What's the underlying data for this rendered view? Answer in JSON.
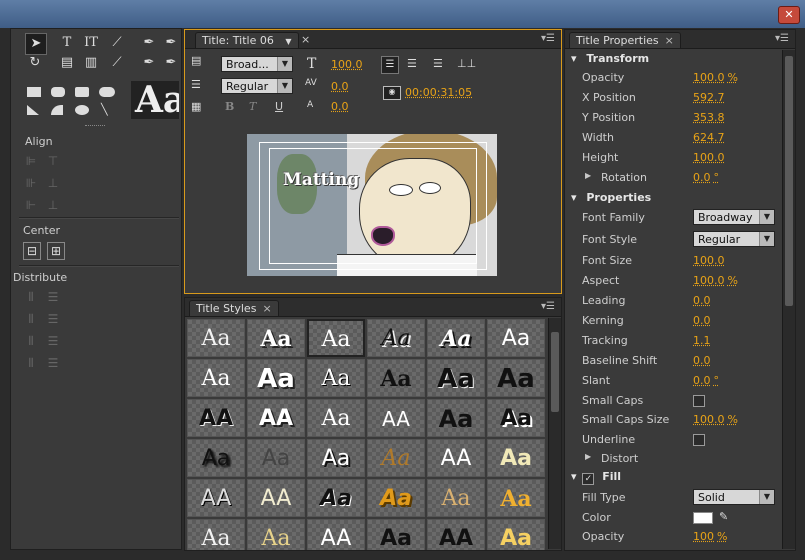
{
  "window": {
    "close_label": "✕"
  },
  "tools": {
    "align": {
      "header": "Align"
    },
    "center": {
      "header": "Center"
    },
    "distribute": {
      "header": "Distribute"
    },
    "preview_glyph": "Aa"
  },
  "title_panel": {
    "tab_label": "Title: Title 06",
    "font_family": "Broad...",
    "font_style": "Regular",
    "font_size": "100.0",
    "kerning": "0.0",
    "leading": "0.0",
    "timecode": "00:00:31:05",
    "bold": "B",
    "italic": "T",
    "underline": "U",
    "canvas_text": "Matting"
  },
  "title_styles": {
    "tab_label": "Title Styles",
    "sample": "Aa",
    "sample_caps": "AA"
  },
  "properties": {
    "tab_label": "Title Properties",
    "transform": {
      "header": "Transform",
      "opacity_label": "Opacity",
      "opacity": "100.0",
      "opacity_unit": "%",
      "x_label": "X Position",
      "x": "592.7",
      "y_label": "Y Position",
      "y": "353.8",
      "width_label": "Width",
      "width": "624.7",
      "height_label": "Height",
      "height": "100.0",
      "rotation_label": "Rotation",
      "rotation": "0.0",
      "rotation_unit": "°"
    },
    "props": {
      "header": "Properties",
      "font_family_label": "Font Family",
      "font_family": "Broadway",
      "font_style_label": "Font Style",
      "font_style": "Regular",
      "font_size_label": "Font Size",
      "font_size": "100.0",
      "aspect_label": "Aspect",
      "aspect": "100.0",
      "aspect_unit": "%",
      "leading_label": "Leading",
      "leading": "0.0",
      "kerning_label": "Kerning",
      "kerning": "0.0",
      "tracking_label": "Tracking",
      "tracking": "1.1",
      "baseline_label": "Baseline Shift",
      "baseline": "0.0",
      "slant_label": "Slant",
      "slant": "0.0",
      "slant_unit": "°",
      "smallcaps_label": "Small Caps",
      "smallcaps_size_label": "Small Caps Size",
      "smallcaps_size": "100.0",
      "smallcaps_size_unit": "%",
      "underline_label": "Underline",
      "distort_label": "Distort"
    },
    "fill": {
      "header": "Fill",
      "fill_type_label": "Fill Type",
      "fill_type": "Solid",
      "color_label": "Color",
      "opacity_label": "Opacity",
      "opacity": "100",
      "opacity_unit": "%"
    }
  },
  "colors": {
    "accent": "#e8a317",
    "panel_bg": "#3a3a3a",
    "highlight_border": "#d89a1c"
  }
}
